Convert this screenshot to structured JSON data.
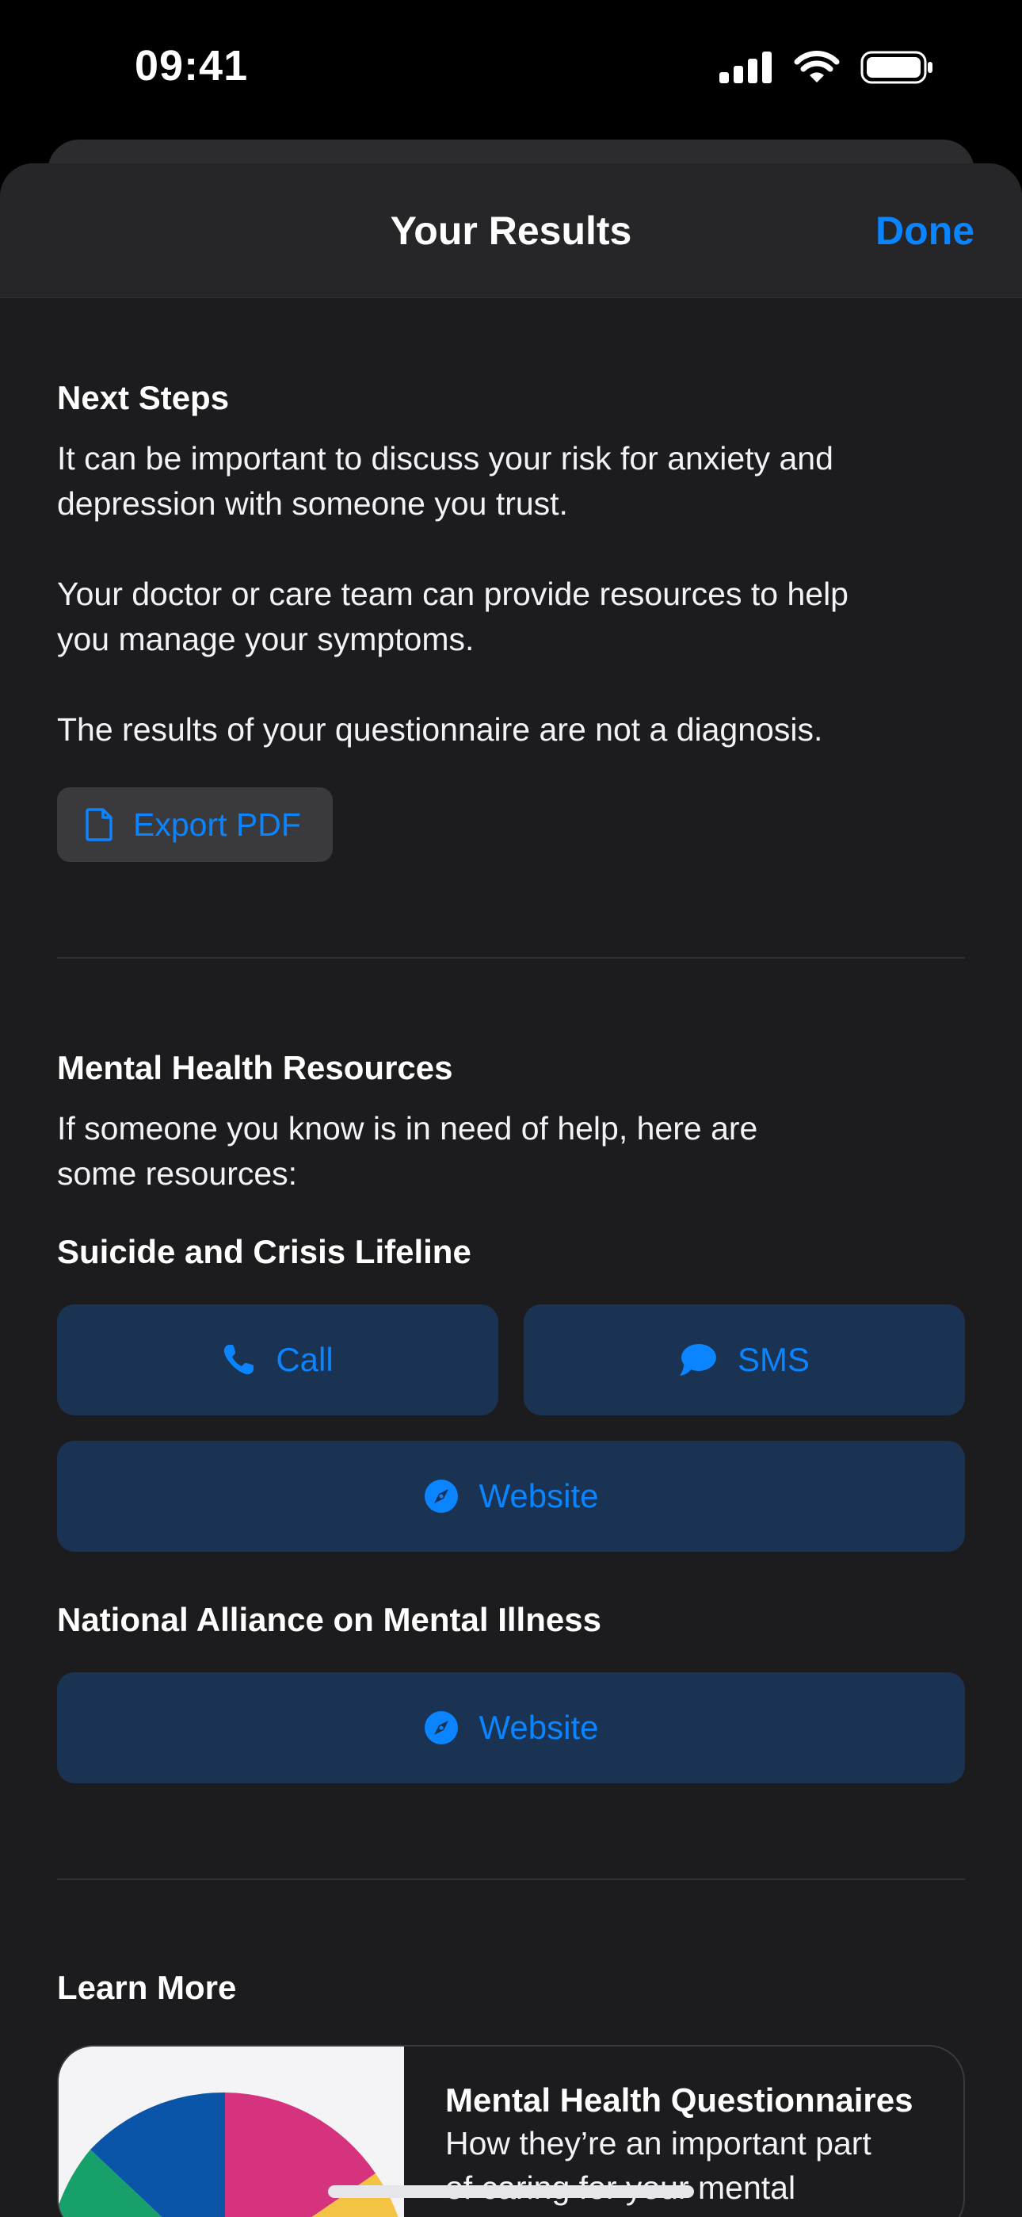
{
  "status_bar": {
    "time": "09:41"
  },
  "nav": {
    "title": "Your Results",
    "done_label": "Done"
  },
  "next_steps": {
    "heading": "Next Steps",
    "p1_line1": "It can be important to discuss your risk for anxiety and",
    "p1_line2": "depression with someone you trust.",
    "p2_line1": "Your doctor or care team can provide resources to help",
    "p2_line2": "you manage your symptoms.",
    "p3": "The results of your questionnaire are not a diagnosis.",
    "export_label": "Export PDF"
  },
  "resources": {
    "heading": "Mental Health Resources",
    "intro_line1": "If someone you know is in need of help, here are",
    "intro_line2": "some resources:",
    "lifeline": {
      "title": "Suicide and Crisis Lifeline",
      "call_label": "Call",
      "sms_label": "SMS",
      "website_label": "Website"
    },
    "nami": {
      "title": "National Alliance on Mental Illness",
      "website_label": "Website"
    }
  },
  "learn_more": {
    "heading": "Learn More",
    "card": {
      "title": "Mental Health Questionnaires",
      "subtitle_line1": "How they’re an important part",
      "subtitle_line2": "of caring for your mental"
    }
  },
  "colors": {
    "accent": "#0a84ff",
    "button_fill": "#1b3352",
    "sheet_background": "#1c1c1e"
  }
}
